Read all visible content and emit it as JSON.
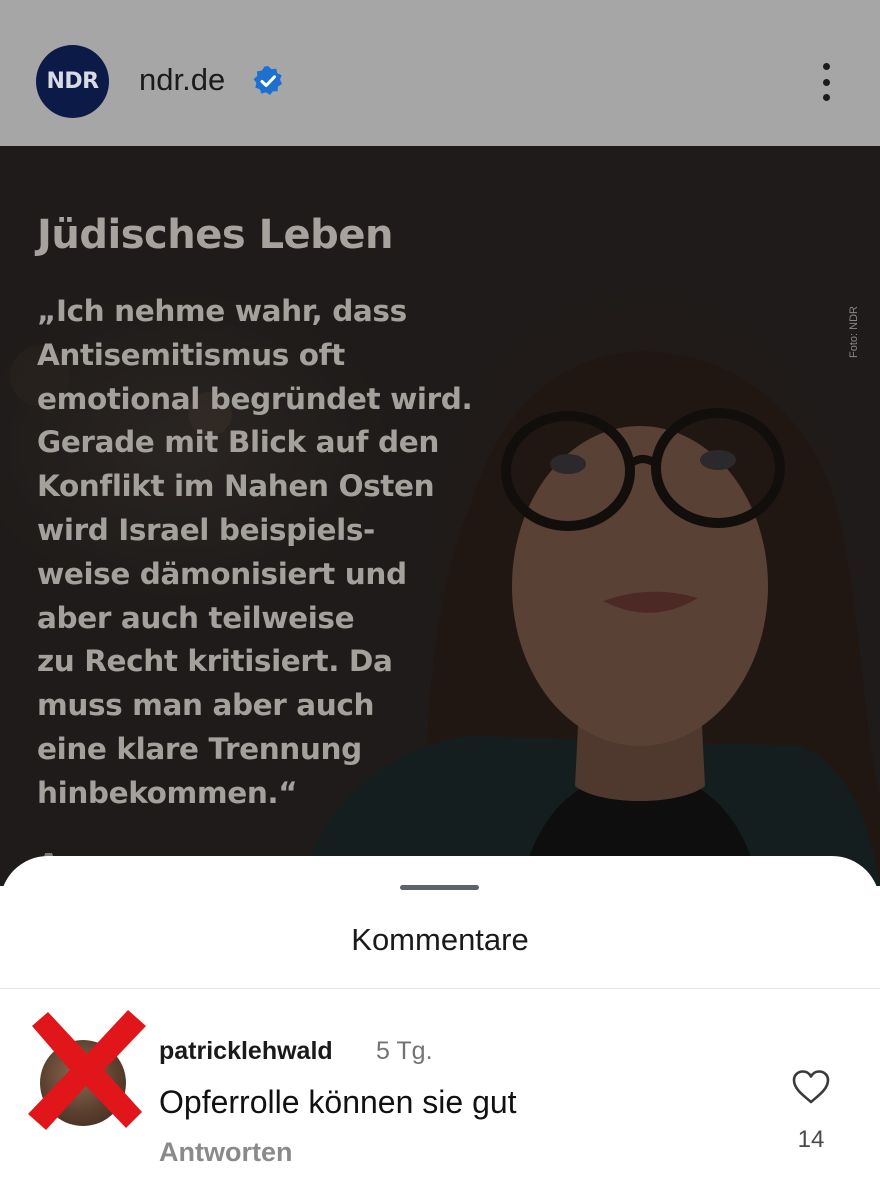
{
  "header": {
    "logo_text": "NDR",
    "account_name": "ndr.de",
    "verified_icon": "verified-badge-icon",
    "more_icon": "more-vertical-icon"
  },
  "image": {
    "photo_credit": "Foto: NDR",
    "heading": "Jüdisches Leben",
    "quote_lines": [
      "„Ich nehme wahr, dass",
      "Antisemitismus oft",
      "emotional begründet wird.",
      "Gerade mit Blick auf den",
      "Konflikt im Nahen Osten",
      "wird Israel beispiels-",
      "weise dämonisiert und",
      "aber auch teilweise",
      "zu Recht kritisiert. Da",
      "muss man aber auch",
      "eine klare Trennung",
      "hinbekommen.“"
    ],
    "cut_text": "A"
  },
  "sheet": {
    "title": "Kommentare"
  },
  "comment": {
    "username": "patricklehwald",
    "time": "5 Tg.",
    "text": "Opferrolle können sie gut",
    "reply_label": "Antworten",
    "like_icon": "heart-outline-icon",
    "like_count": "14"
  },
  "colors": {
    "overlay_header": "#a6a6a6",
    "image_text": "#a4a09c",
    "ndr_blue": "#0b1a47",
    "verified_blue": "#1d6fd0",
    "red_x": "#e0161b"
  }
}
